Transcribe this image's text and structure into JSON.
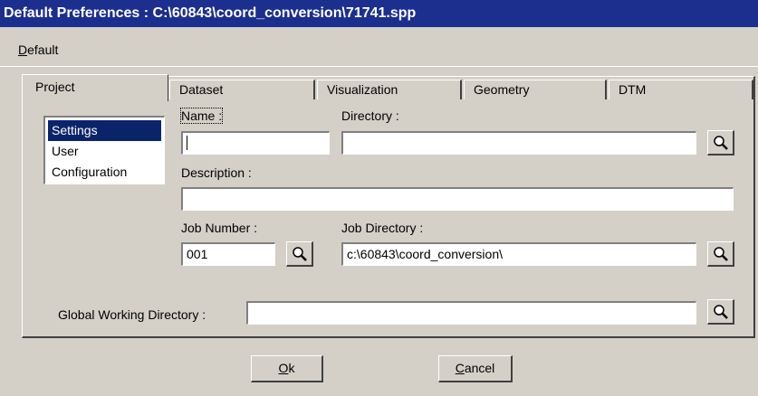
{
  "window": {
    "title": "Default Preferences : C:\\60843\\coord_conversion\\71741.spp"
  },
  "menu": {
    "default_first": "D",
    "default_rest": "efault"
  },
  "tabs": [
    {
      "label": "Project"
    },
    {
      "label": "Dataset"
    },
    {
      "label": "Visualization"
    },
    {
      "label": "Geometry"
    },
    {
      "label": "DTM"
    }
  ],
  "sections": [
    {
      "label": "Settings",
      "selected": true
    },
    {
      "label": "User",
      "selected": false
    },
    {
      "label": "Configuration",
      "selected": false
    }
  ],
  "form": {
    "name_label": "Name :",
    "name_value": "",
    "directory_label": "Directory :",
    "directory_value": "",
    "description_label": "Description :",
    "description_value": "",
    "job_number_label": "Job Number :",
    "job_number_value": "001",
    "job_directory_label": "Job Directory :",
    "job_directory_value": "c:\\60843\\coord_conversion\\",
    "global_dir_label": "Global Working Directory :",
    "global_dir_value": ""
  },
  "buttons": {
    "ok_first": "O",
    "ok_rest": "k",
    "cancel_first": "C",
    "cancel_rest": "ancel"
  },
  "icons": {
    "browse": "magnifier-icon"
  }
}
